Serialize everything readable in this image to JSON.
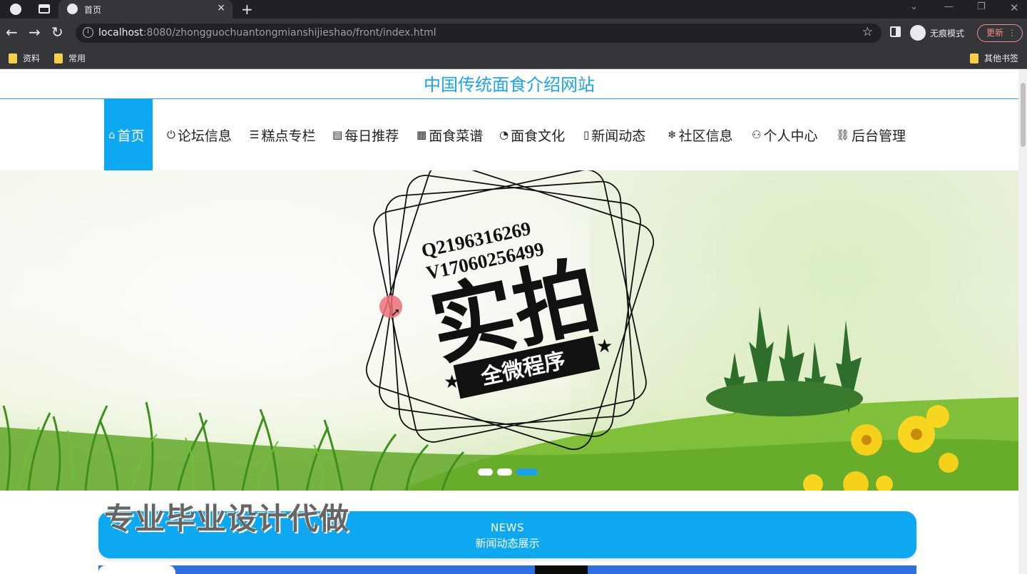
{
  "browser": {
    "tab_title": "首页",
    "close_glyph": "×",
    "new_tab_glyph": "+",
    "url_host": "localhost",
    "url_rest": ":8080/zhongguochuantongmianshijieshao/front/index.html",
    "incognito_label": "无痕模式",
    "update_label": "更新",
    "bookmarks": [
      "资料",
      "常用"
    ],
    "other_bookmarks": "其他书签"
  },
  "site": {
    "title": "中国传统面食介绍网站",
    "nav": [
      {
        "label": "首页",
        "icon": "⌂"
      },
      {
        "label": "论坛信息",
        "icon": "⏻"
      },
      {
        "label": "糕点专栏",
        "icon": "☰"
      },
      {
        "label": "每日推荐",
        "icon": "▤"
      },
      {
        "label": "面食菜谱",
        "icon": "▦"
      },
      {
        "label": "面食文化",
        "icon": "◔"
      },
      {
        "label": "新闻动态",
        "icon": "▯"
      },
      {
        "label": "社区信息",
        "icon": "❄"
      },
      {
        "label": "个人中心",
        "icon": "⚇"
      },
      {
        "label": "后台管理",
        "icon": "⛓"
      }
    ]
  },
  "banner": {
    "stamp_line1": "Q2196316269",
    "stamp_line2": "V17060256499",
    "stamp_big": "实拍",
    "stamp_ribbon": "全微程序"
  },
  "news": {
    "heading_en": "NEWS",
    "heading_cn": "新闻动态展示",
    "watermark": "专业毕业设计代做"
  },
  "colors": {
    "accent": "#0ea8f0",
    "title": "#1fa3e3"
  }
}
